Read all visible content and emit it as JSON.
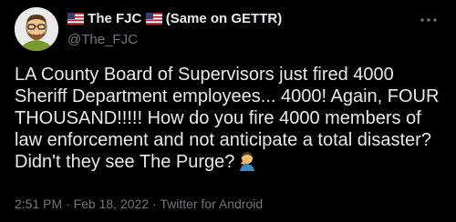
{
  "tweet": {
    "display_name": "The FJC",
    "display_suffix": "(Same on GETTR)",
    "handle": "@The_FJC",
    "avatar_icon": "cartoon-avatar-icon",
    "more_icon": "more-options-icon",
    "text": "LA County Board of Supervisors just fired 4000 Sheriff Department employees... 4000! Again, FOUR THOUSAND!!!!! How do you fire 4000 members of law enforcement and not anticipate a total disaster? Didn't they see The Purge?",
    "trailing_emoji": "man-facepalming-emoji",
    "time": "2:51 PM",
    "separator": "·",
    "date": "Feb 18, 2022",
    "source": "Twitter for Android"
  },
  "colors": {
    "background": "#000000",
    "primary_text": "#e7e9ea",
    "secondary_text": "#71767b"
  }
}
